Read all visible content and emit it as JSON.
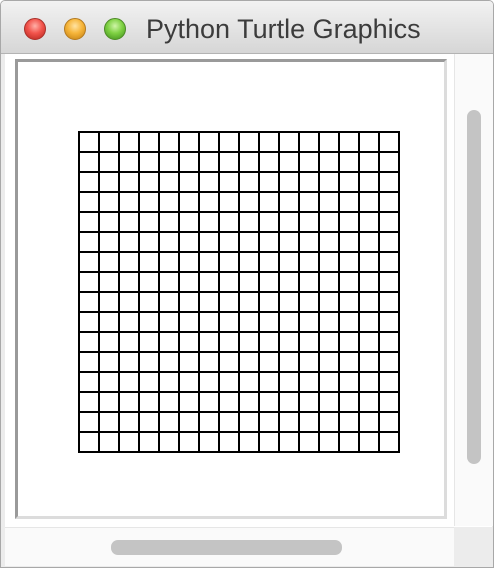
{
  "window": {
    "title": "Python Turtle Graphics",
    "controls": [
      "close",
      "minimize",
      "zoom"
    ],
    "colors": {
      "close": "#f2544c",
      "minimize": "#f6b53a",
      "zoom": "#7fd143"
    }
  },
  "canvas": {
    "background": "#ffffff",
    "grid": {
      "rows": 16,
      "columns": 16,
      "line_color": "#000000"
    }
  },
  "scrollbars": {
    "vertical": "visible",
    "horizontal": "visible"
  }
}
